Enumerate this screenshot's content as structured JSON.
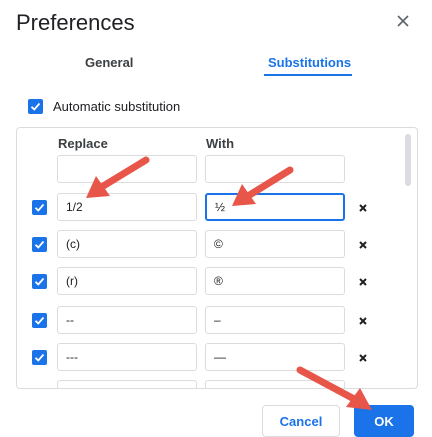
{
  "dialog": {
    "title": "Preferences"
  },
  "tabs": [
    {
      "label": "General",
      "selected": false
    },
    {
      "label": "Substitutions",
      "selected": true
    }
  ],
  "automatic_substitution": {
    "label": "Automatic substitution",
    "checked": true
  },
  "table": {
    "headers": {
      "replace": "Replace",
      "with": "With"
    },
    "new_row": {
      "replace": "",
      "with": ""
    },
    "rows": [
      {
        "checked": true,
        "replace": "1/2",
        "with": "½"
      },
      {
        "checked": true,
        "replace": "(c)",
        "with": "©"
      },
      {
        "checked": true,
        "replace": "(r)",
        "with": "®"
      },
      {
        "checked": true,
        "replace": "--",
        "with": "–"
      },
      {
        "checked": true,
        "replace": "---",
        "with": "—"
      }
    ]
  },
  "buttons": {
    "cancel": "Cancel",
    "ok": "OK"
  },
  "colors": {
    "accent": "#1a73e8",
    "annotation_arrow": "#e8564a",
    "border": "#dadce0"
  },
  "icons": {
    "close": "close-icon",
    "row_delete": "x-icon",
    "checkbox": "checkmark-icon"
  }
}
